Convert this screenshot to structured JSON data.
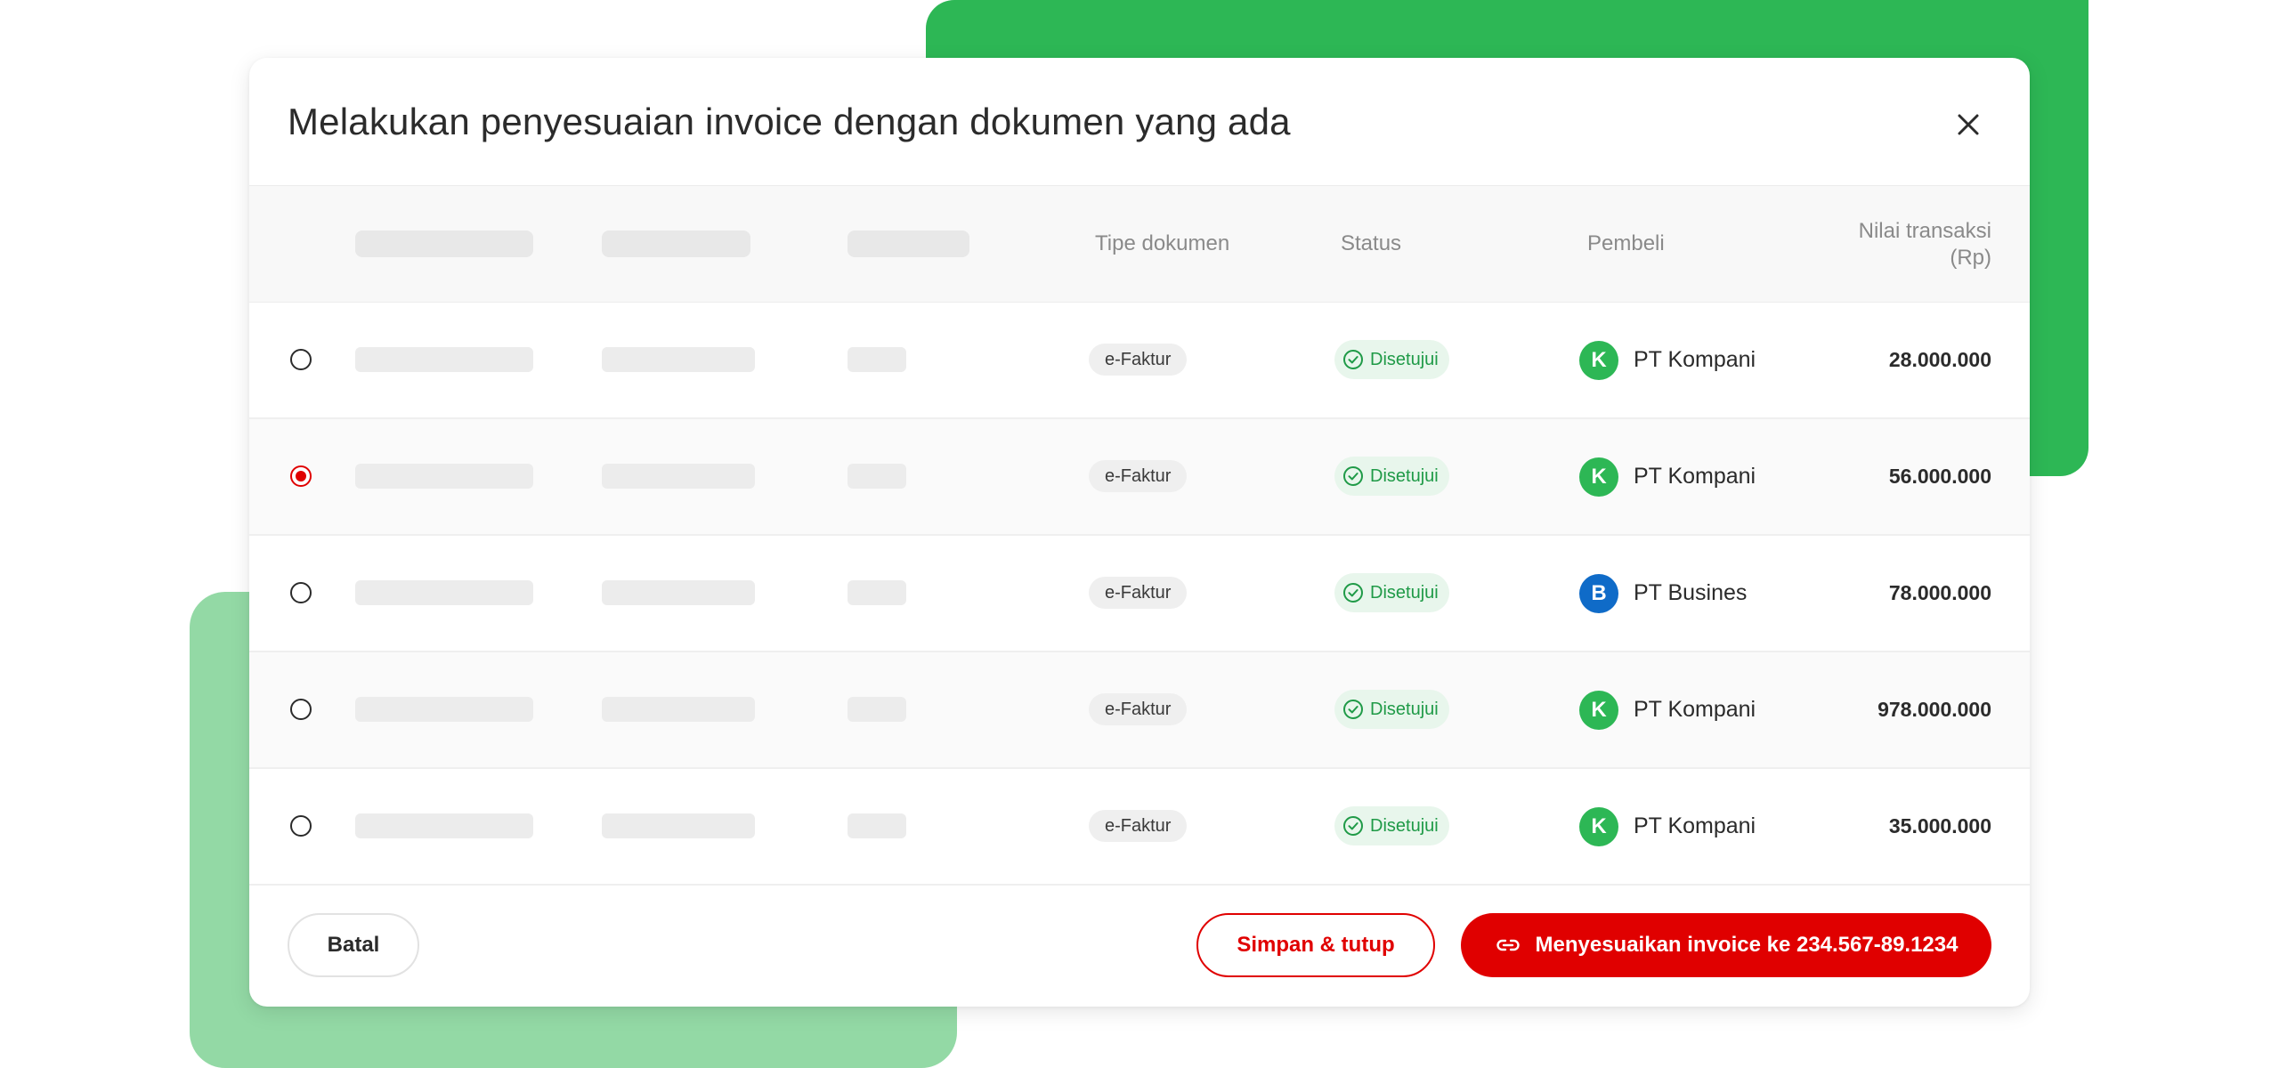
{
  "colors": {
    "accent_red": "#e00000",
    "deco_green": "#2db755",
    "deco_green_light": "#93d9a5",
    "status_green": "#1f9a47",
    "avatar_green": "#2db755",
    "avatar_blue": "#0f6bc8"
  },
  "modal": {
    "title": "Melakukan penyesuaian invoice dengan dokumen yang ada",
    "close_icon": "close-icon"
  },
  "table": {
    "columns": {
      "tipe_dokumen": "Tipe dokumen",
      "status": "Status",
      "pembeli": "Pembeli",
      "nilai_line1": "Nilai transaksi",
      "nilai_line2": "(Rp)"
    },
    "rows": [
      {
        "selected": false,
        "doc_type": "e-Faktur",
        "status": "Disetujui",
        "avatar": "K",
        "avatar_color": "#2db755",
        "buyer": "PT Kompani",
        "amount": "28.000.000"
      },
      {
        "selected": true,
        "doc_type": "e-Faktur",
        "status": "Disetujui",
        "avatar": "K",
        "avatar_color": "#2db755",
        "buyer": "PT Kompani",
        "amount": "56.000.000"
      },
      {
        "selected": false,
        "doc_type": "e-Faktur",
        "status": "Disetujui",
        "avatar": "B",
        "avatar_color": "#0f6bc8",
        "buyer": "PT Busines",
        "amount": "78.000.000"
      },
      {
        "selected": false,
        "doc_type": "e-Faktur",
        "status": "Disetujui",
        "avatar": "K",
        "avatar_color": "#2db755",
        "buyer": "PT Kompani",
        "amount": "978.000.000"
      },
      {
        "selected": false,
        "doc_type": "e-Faktur",
        "status": "Disetujui",
        "avatar": "K",
        "avatar_color": "#2db755",
        "buyer": "PT Kompani",
        "amount": "35.000.000"
      }
    ]
  },
  "footer": {
    "cancel_label": "Batal",
    "save_close_label": "Simpan & tutup",
    "primary_label": "Menyesuaikan invoice ke 234.567-89.1234",
    "primary_icon": "link-icon"
  }
}
